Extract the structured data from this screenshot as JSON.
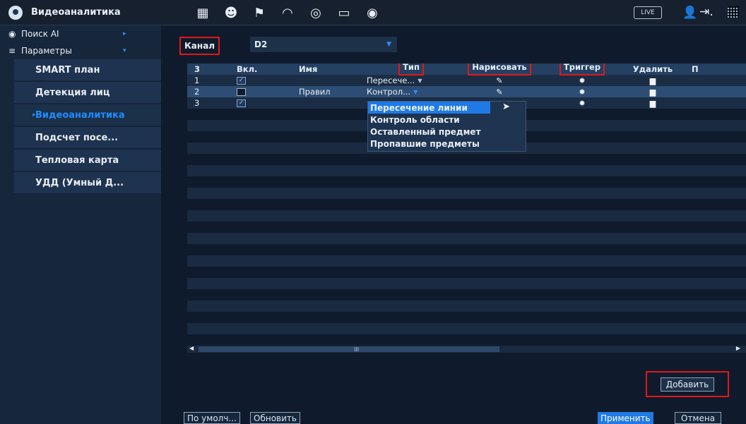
{
  "app": {
    "title": "Видеоаналитика"
  },
  "topbar": {
    "icons": [
      "storage-icon",
      "face-icon",
      "alarm-icon",
      "performance-icon",
      "record-icon",
      "display-icon",
      "audio-icon"
    ],
    "icon_glyphs": [
      "▦",
      "☻",
      "⚑",
      "◠",
      "◎",
      "▭",
      "◉"
    ],
    "live_label": "LIVE",
    "user_glyph": "👤",
    "logout_glyph": "⇥."
  },
  "sidebar": {
    "top": [
      {
        "label": "Поиск AI",
        "icon": "◉"
      },
      {
        "label": "Параметры",
        "icon": "≡"
      }
    ],
    "items": [
      {
        "label": "SMART план"
      },
      {
        "label": "Детекция лиц"
      },
      {
        "label": "Видеоаналитика",
        "active": true
      },
      {
        "label": "Подсчет посе..."
      },
      {
        "label": "Тепловая карта"
      },
      {
        "label": "УДД (Умный Д..."
      }
    ]
  },
  "main": {
    "channel_label": "Канал",
    "channel_value": "D2",
    "table": {
      "headers": {
        "count": "3",
        "enabled": "Вкл.",
        "name": "Имя",
        "type": "Тип",
        "draw": "Нарисовать",
        "trigger": "Триггер",
        "delete": "Удалить",
        "more": "П"
      },
      "rows": [
        {
          "num": "1",
          "name": "",
          "type": "Пересече..."
        },
        {
          "num": "2",
          "name": "Правил",
          "type": "Контрол..."
        },
        {
          "num": "3",
          "name": "",
          "type": ""
        }
      ]
    },
    "type_dropdown": {
      "options": [
        "Пересечение линии",
        "Контроль области",
        "Оставленный предмет",
        "Пропавшие предметы"
      ]
    },
    "scroll_grip": "III",
    "add_button": "Добавить",
    "footer": {
      "default_button": "По умолч...",
      "refresh_button": "Обновить",
      "apply_button": "Применить",
      "cancel_button": "Отмена"
    }
  },
  "colors": {
    "accent": "#1f7ae6",
    "highlight_red": "#e01818",
    "background": "#0f1b2c"
  }
}
